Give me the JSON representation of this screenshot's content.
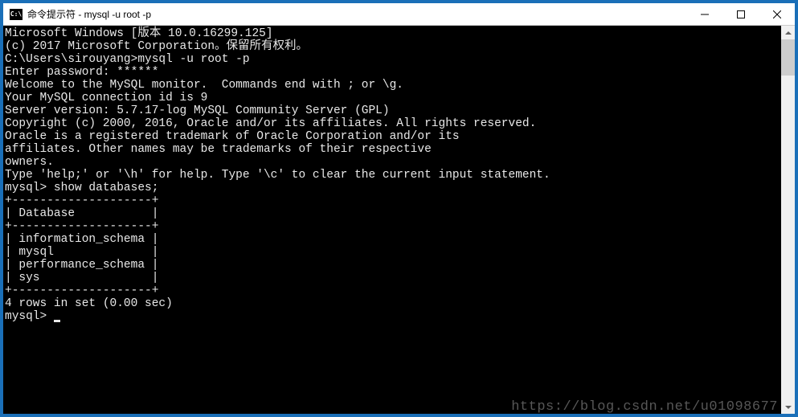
{
  "window": {
    "icon_text": "C:\\",
    "title": "命令提示符 - mysql  -u root -p"
  },
  "term": {
    "l01": "Microsoft Windows [版本 10.0.16299.125]",
    "l02": "(c) 2017 Microsoft Corporation。保留所有权利。",
    "l03": "",
    "l04": "C:\\Users\\sirouyang>mysql -u root -p",
    "l05": "Enter password: ******",
    "l06": "Welcome to the MySQL monitor.  Commands end with ; or \\g.",
    "l07": "Your MySQL connection id is 9",
    "l08": "Server version: 5.7.17-log MySQL Community Server (GPL)",
    "l09": "",
    "l10": "Copyright (c) 2000, 2016, Oracle and/or its affiliates. All rights reserved.",
    "l11": "",
    "l12": "Oracle is a registered trademark of Oracle Corporation and/or its",
    "l13": "affiliates. Other names may be trademarks of their respective",
    "l14": "owners.",
    "l15": "",
    "l16": "Type 'help;' or '\\h' for help. Type '\\c' to clear the current input statement.",
    "l17": "",
    "l18": "mysql> show databases;",
    "l19": "+--------------------+",
    "l20": "| Database           |",
    "l21": "+--------------------+",
    "l22": "| information_schema |",
    "l23": "| mysql              |",
    "l24": "| performance_schema |",
    "l25": "| sys                |",
    "l26": "+--------------------+",
    "l27": "4 rows in set (0.00 sec)",
    "l28": "",
    "l29": "mysql> "
  },
  "watermark": "https://blog.csdn.net/u01098677"
}
